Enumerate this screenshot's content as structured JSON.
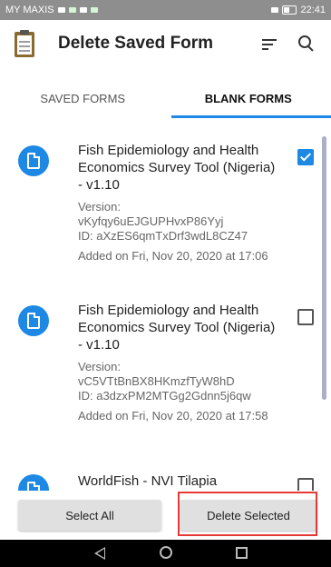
{
  "status_bar": {
    "carrier": "MY MAXIS",
    "time": "22:41"
  },
  "app_bar": {
    "title": "Delete Saved Form"
  },
  "tabs": [
    {
      "label": "SAVED FORMS",
      "active": false
    },
    {
      "label": "BLANK FORMS",
      "active": true
    }
  ],
  "forms": [
    {
      "title": "Fish Epidemiology and Health Economics Survey Tool (Nigeria) - v1.10",
      "version_label": "Version:",
      "version": "vKyfqy6uEJGUPHvxP86Yyj",
      "id": "ID: aXzES6qmTxDrf3wdL8CZ47",
      "added": "Added on Fri, Nov 20, 2020 at 17:06",
      "checked": true
    },
    {
      "title": "Fish Epidemiology and Health Economics Survey Tool (Nigeria) - v1.10",
      "version_label": "Version:",
      "version": "vC5VTtBnBX8HKmzfTyW8hD",
      "id": "ID: a3dzxPM2MTGg2Gdnn5j6qw",
      "added": "Added on Fri, Nov 20, 2020 at 17:58",
      "checked": false
    },
    {
      "title": "WorldFish - NVI Tilapia Epidemiology and Health",
      "checked": false
    }
  ],
  "buttons": {
    "select_all": "Select All",
    "delete_selected": "Delete Selected"
  },
  "colors": {
    "accent": "#1e88e5",
    "highlight": "#e53935"
  }
}
